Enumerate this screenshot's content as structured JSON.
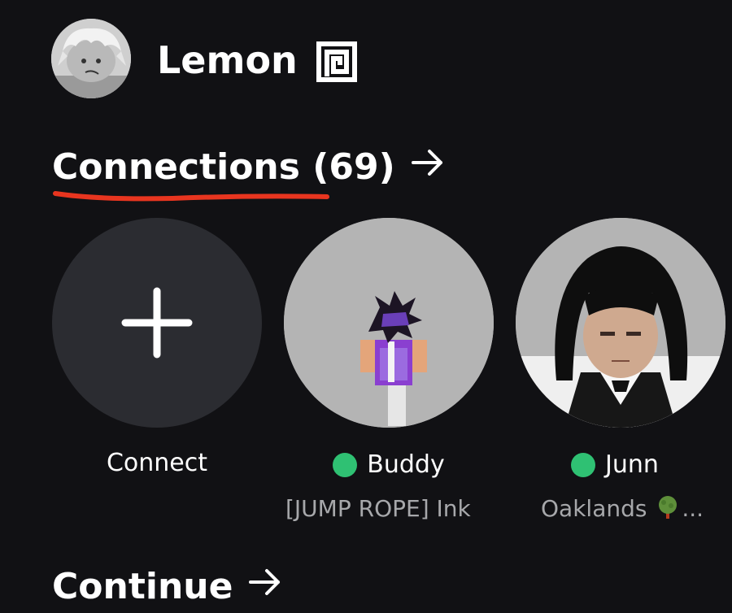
{
  "profile": {
    "username": "Lemon",
    "verified_icon": "verified-badge-icon"
  },
  "connections": {
    "title": "Connections (69)",
    "arrow_icon": "arrow-right-icon",
    "underline_color": "#e8351f",
    "items": [
      {
        "label": "Connect",
        "icon": "plus-icon"
      },
      {
        "name": "Buddy",
        "status": "online",
        "activity": "[JUMP ROPE] Ink"
      },
      {
        "name": "Junn",
        "status": "online",
        "activity": "Oaklands",
        "activity_icon": "tree-icon",
        "activity_suffix": "..."
      }
    ]
  },
  "continue": {
    "title": "Continue",
    "arrow_icon": "arrow-right-icon"
  },
  "colors": {
    "background": "#111114",
    "online": "#2fc173",
    "card_bg": "#2b2c31",
    "secondary_text": "#a7a8ab"
  }
}
